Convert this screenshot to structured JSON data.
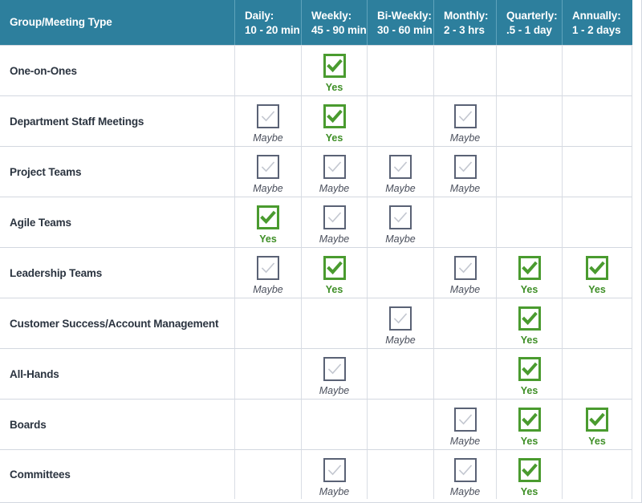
{
  "table": {
    "columns": [
      {
        "name": "Group/Meeting Type",
        "duration": ""
      },
      {
        "name": "Daily:",
        "duration": "10 - 20 min"
      },
      {
        "name": "Weekly:",
        "duration": "45 - 90 min"
      },
      {
        "name": "Bi-Weekly:",
        "duration": "30 - 60 min"
      },
      {
        "name": "Monthly:",
        "duration": "2 - 3 hrs"
      },
      {
        "name": "Quarterly:",
        "duration": ".5 - 1 day"
      },
      {
        "name": "Annually:",
        "duration": "1 - 2 days"
      }
    ],
    "marker_labels": {
      "yes": "Yes",
      "maybe": "Maybe",
      "none": ""
    },
    "colors": {
      "header_bg": "#2d7f9d",
      "yes_green": "#4a9b2f",
      "yes_text": "#3f8f27",
      "maybe_border": "#5a6275",
      "maybe_text": "#4a4f5c",
      "row_alt_bg": "#eef0f4",
      "row_bg": "#ffffff",
      "label_text": "#2b3440"
    },
    "rows": [
      {
        "label": "One-on-Ones",
        "cells": [
          "none",
          "yes",
          "none",
          "none",
          "none",
          "none"
        ]
      },
      {
        "label": "Department Staff Meetings",
        "cells": [
          "maybe",
          "yes",
          "none",
          "maybe",
          "none",
          "none"
        ]
      },
      {
        "label": "Project Teams",
        "cells": [
          "maybe",
          "maybe",
          "maybe",
          "maybe",
          "none",
          "none"
        ]
      },
      {
        "label": "Agile Teams",
        "cells": [
          "yes",
          "maybe",
          "maybe",
          "none",
          "none",
          "none"
        ]
      },
      {
        "label": "Leadership Teams",
        "cells": [
          "maybe",
          "yes",
          "none",
          "maybe",
          "yes",
          "yes"
        ]
      },
      {
        "label": "Customer Success/Account Management",
        "cells": [
          "none",
          "none",
          "maybe",
          "none",
          "yes",
          "none"
        ]
      },
      {
        "label": "All-Hands",
        "cells": [
          "none",
          "maybe",
          "none",
          "none",
          "yes",
          "none"
        ]
      },
      {
        "label": "Boards",
        "cells": [
          "none",
          "none",
          "none",
          "maybe",
          "yes",
          "yes"
        ]
      },
      {
        "label": "Committees",
        "cells": [
          "none",
          "maybe",
          "none",
          "maybe",
          "yes",
          "none"
        ]
      }
    ]
  }
}
